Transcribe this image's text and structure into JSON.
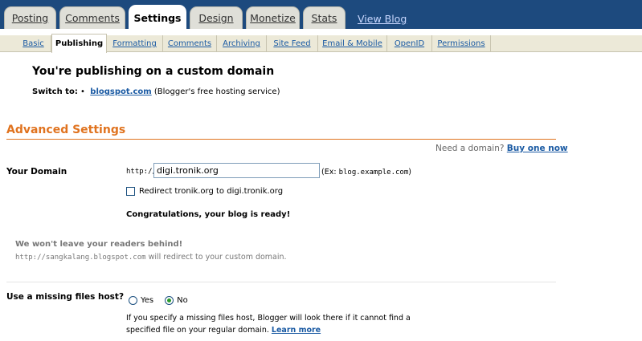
{
  "tabs": [
    {
      "label": "Posting"
    },
    {
      "label": "Comments"
    },
    {
      "label": "Settings",
      "active": true
    },
    {
      "label": "Design"
    },
    {
      "label": "Monetize"
    },
    {
      "label": "Stats"
    }
  ],
  "view_blog": "View Blog",
  "subtabs": [
    {
      "label": "Basic"
    },
    {
      "label": "Publishing",
      "active": true
    },
    {
      "label": "Formatting"
    },
    {
      "label": "Comments"
    },
    {
      "label": "Archiving"
    },
    {
      "label": "Site Feed"
    },
    {
      "label": "Email & Mobile"
    },
    {
      "label": "OpenID"
    },
    {
      "label": "Permissions"
    }
  ],
  "publishing": {
    "heading": "You're publishing on a custom domain",
    "switch_label": "Switch to:",
    "switch_bullet": "•",
    "switch_link": "blogspot.com",
    "switch_desc": "(Blogger's free hosting service)"
  },
  "advanced": {
    "title": "Advanced Settings",
    "need_domain": "Need a domain?",
    "buy_link": "Buy one now",
    "your_domain_label": "Your Domain",
    "http_prefix": "http://",
    "domain_value": "digi.tronik.org",
    "ex_prefix": "(Ex:",
    "ex_value": "blog.example.com",
    "ex_suffix": ")",
    "redirect_label": "Redirect tronik.org to digi.tronik.org",
    "congrats": "Congratulations, your blog is ready!"
  },
  "readers": {
    "title": "We won't leave your readers behind!",
    "old_url": "http://sangkalang.blogspot.com",
    "redirect_text": "will redirect to your custom domain."
  },
  "missing_host": {
    "label": "Use a missing files host?",
    "yes": "Yes",
    "no": "No",
    "selected": "No",
    "help": "If you specify a missing files host, Blogger will look there if it cannot find a specified file on your regular domain.",
    "learn_more": "Learn more"
  },
  "colors": {
    "topbar": "#1d4a7e",
    "accent_orange": "#e0731f",
    "link_blue": "#1a5aa3"
  }
}
